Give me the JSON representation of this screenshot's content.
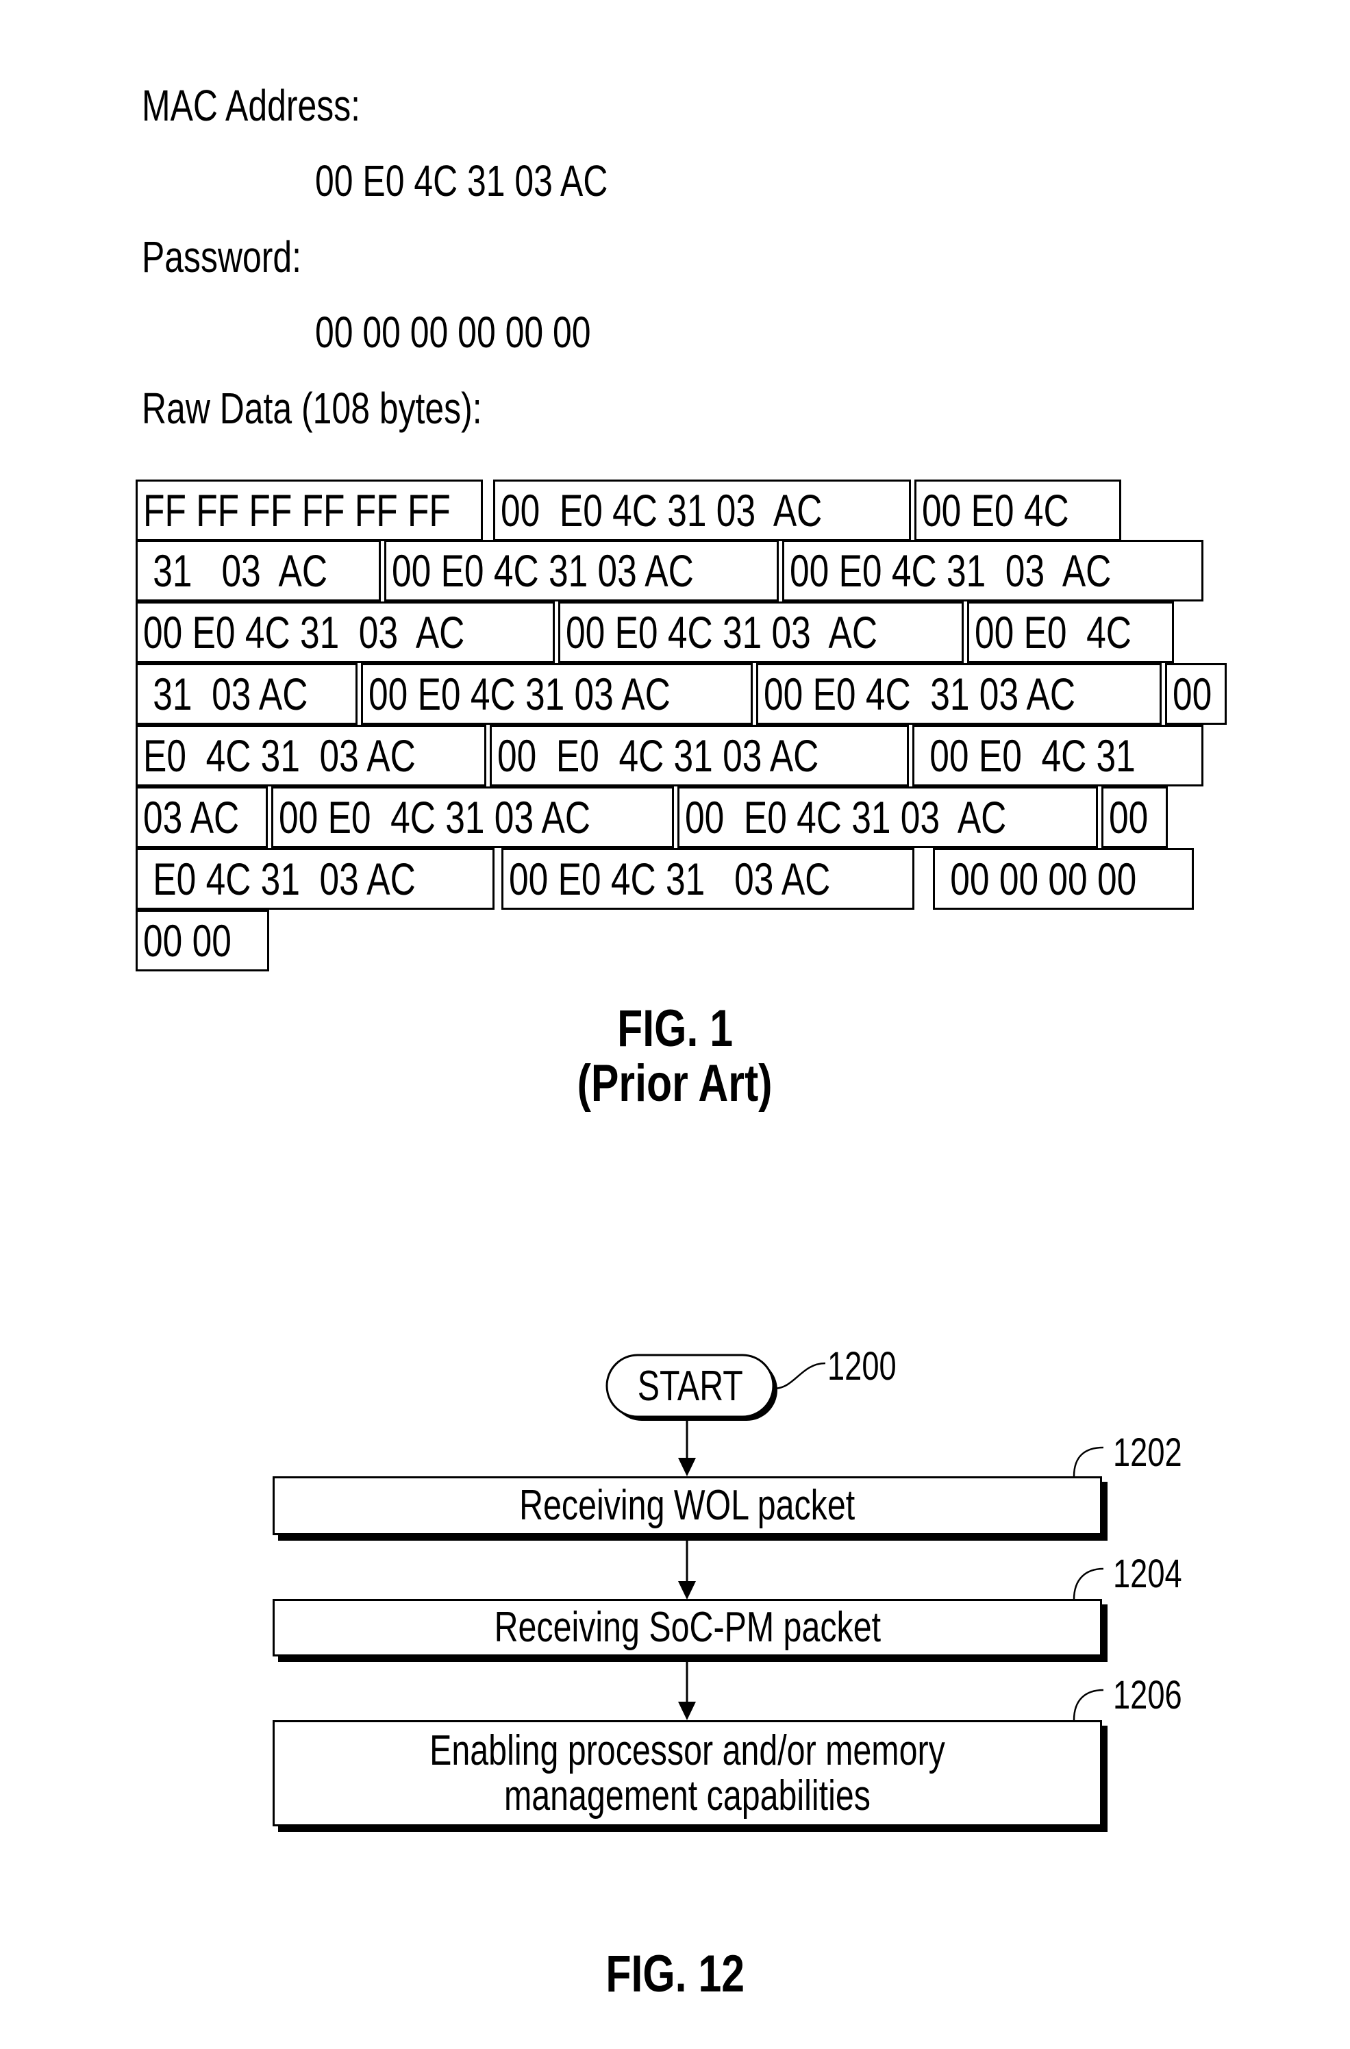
{
  "fig1": {
    "mac_label": "MAC Address:",
    "mac_value": "00 E0 4C 31 03 AC",
    "password_label": "Password:",
    "password_value": "00 00 00 00 00 00",
    "raw_label": "Raw Data (108 bytes):",
    "raw_rows": [
      [
        "FF FF FF FF FF FF",
        "00  E0 4C 31 03  AC",
        "00 E0 4C"
      ],
      [
        " 31   03  AC",
        "00 E0 4C 31 03 AC",
        "00 E0 4C 31  03  AC"
      ],
      [
        "00 E0 4C 31  03  AC",
        "00 E0 4C 31 03  AC",
        "00 E0  4C"
      ],
      [
        " 31  03 AC",
        "00 E0 4C 31 03 AC",
        "00 E0 4C  31 03 AC",
        "00"
      ],
      [
        "E0  4C 31  03 AC",
        "00  E0  4C 31 03 AC",
        " 00 E0  4C 31"
      ],
      [
        "03 AC",
        "00 E0  4C 31 03 AC",
        "00  E0 4C 31 03  AC",
        "00"
      ],
      [
        " E0 4C 31  03 AC",
        "00 E0 4C 31   03 AC",
        " 00 00 00 00"
      ],
      [
        "00 00"
      ]
    ],
    "caption_line1": "FIG. 1",
    "caption_line2": "(Prior Art)"
  },
  "fig12": {
    "start": {
      "label": "START",
      "ref": "1200"
    },
    "steps": [
      {
        "ref": "1202",
        "label": "Receiving WOL packet"
      },
      {
        "ref": "1204",
        "label": "Receiving SoC-PM packet"
      },
      {
        "ref": "1206",
        "label": "Enabling processor and/or memory\nmanagement capabilities"
      }
    ],
    "caption": "FIG. 12"
  }
}
